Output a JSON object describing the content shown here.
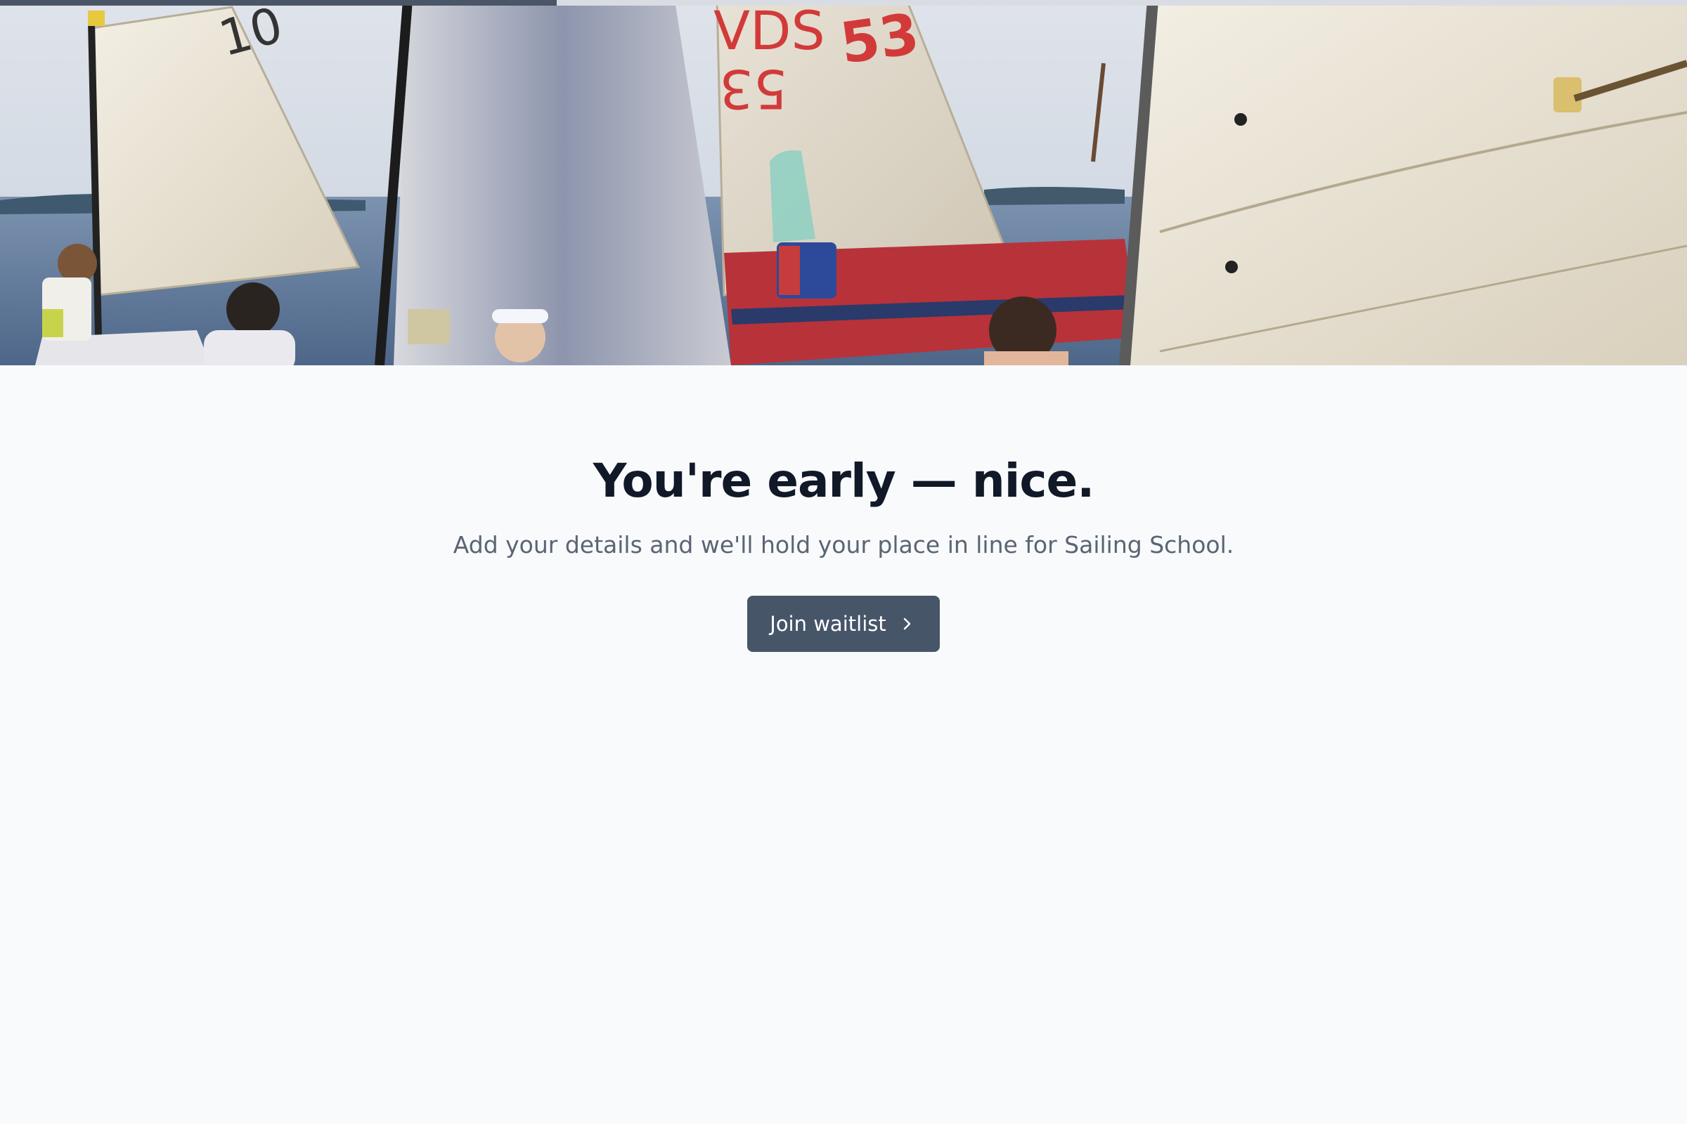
{
  "progress": {
    "fraction": 0.33
  },
  "hero": {
    "alt_icon": "sailboats-photo",
    "sail_numbers": [
      "53",
      "VDS",
      "53"
    ]
  },
  "main": {
    "headline": "You're early — nice.",
    "subtitle": "Add your details and we'll hold your place in line for Sailing School.",
    "cta_label": "Join waitlist",
    "cta_icon": "chevron-right-icon"
  },
  "colors": {
    "background": "#f8fafc",
    "headline": "#111827",
    "subtitle": "#5b6472",
    "button": "#475569",
    "progress_fill": "#4a5568",
    "progress_track": "#d9dde3"
  }
}
